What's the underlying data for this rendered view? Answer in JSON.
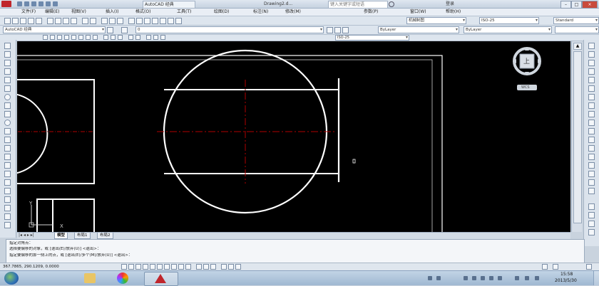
{
  "titlebar": {
    "app_title": "AutoCAD 经典",
    "drawing_name": "Drawing2.d...",
    "search_placeholder": "键入关键字或短语",
    "login": "登录"
  },
  "menu": [
    "文件(F)",
    "编辑(E)",
    "视图(V)",
    "插入(I)",
    "格式(O)",
    "工具(T)",
    "绘图(D)",
    "标注(N)",
    "修改(M)",
    "参数(P)",
    "窗口(W)",
    "帮助(H)"
  ],
  "toolbars": {
    "workspace": "AutoCAD 经典",
    "layer_combo": "0",
    "annotation_style": "机械制图",
    "dim_style": "ISO-25",
    "dim_style_2": "ISO-25",
    "text_style": "Standard",
    "color_combo": "ByLayer",
    "linetype_combo": "ByLayer"
  },
  "viewcube": {
    "face_label": "上",
    "wcs_label": "WCS"
  },
  "ucs": {
    "x_label": "X",
    "y_label": "Y"
  },
  "tabs": [
    "模型",
    "布局1",
    "布局2"
  ],
  "command": {
    "line1": "指定对角点：",
    "line2": "选择要偏移的对象，或 [退出(E)/放弃(U)] <退出>：",
    "line3": "指定要偏移的那一侧上的点，或 [退出(E)/多个(M)/放弃(U)] <退出>："
  },
  "status": {
    "coords": "367.7865, 290.1209, 0.0000"
  },
  "clock": {
    "time": "15:58",
    "date": "2013/5/30"
  },
  "colors": {
    "canvas": "#000000",
    "lines": "#ffffff",
    "centerline": "#b00000"
  }
}
